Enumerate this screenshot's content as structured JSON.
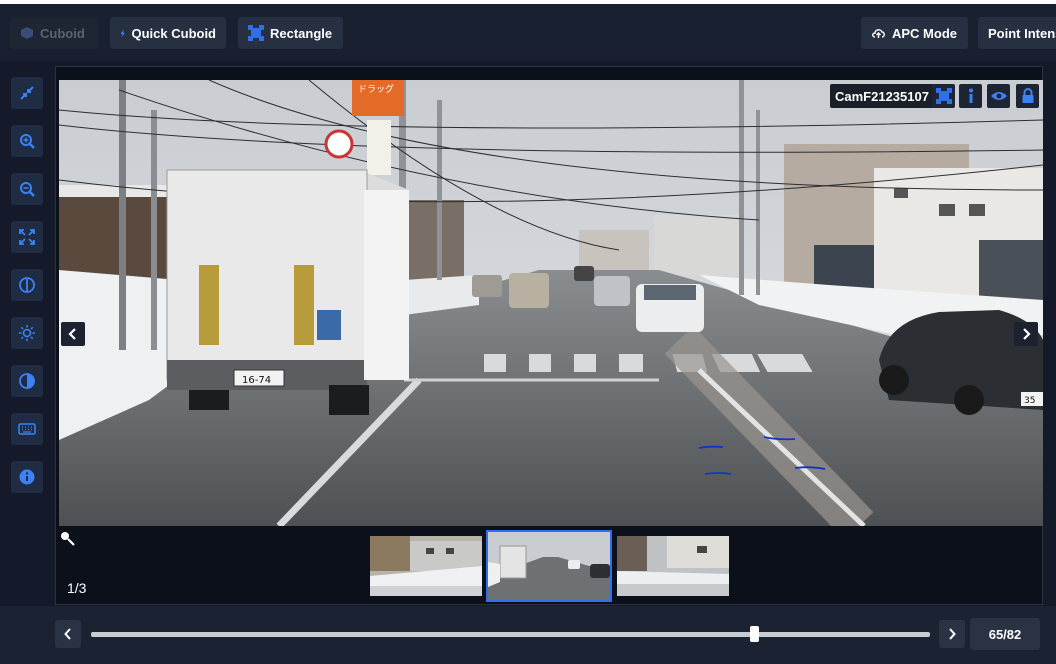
{
  "toolbar": {
    "cuboid_label": "Cuboid",
    "quick_cuboid_label": "Quick Cuboid",
    "rectangle_label": "Rectangle",
    "apc_mode_label": "APC Mode",
    "point_intensity_label": "Point Intens"
  },
  "sidebar": {
    "items": [
      {
        "icon": "collapse-icon"
      },
      {
        "icon": "zoom-in-icon"
      },
      {
        "icon": "zoom-out-icon"
      },
      {
        "icon": "fit-screen-icon"
      },
      {
        "icon": "half-circle-icon"
      },
      {
        "icon": "brightness-icon"
      },
      {
        "icon": "contrast-icon"
      },
      {
        "icon": "keyboard-icon"
      },
      {
        "icon": "info-icon"
      }
    ]
  },
  "camera": {
    "name": "CamF21235107",
    "icons": [
      "bounding-box-icon",
      "info-icon",
      "eye-icon",
      "lock-icon"
    ]
  },
  "gallery": {
    "counter": "1/3",
    "selected_index": 1
  },
  "scene": {
    "truck_plate": "16-74",
    "car_plate": "35",
    "sign_top": "ドラッグ"
  },
  "timeline": {
    "frame_label": "65/82",
    "current": 65,
    "total": 82
  },
  "colors": {
    "accent": "#2f6fe8",
    "toolbar_bg": "#19202f",
    "icon_blue": "#3b82f6"
  }
}
